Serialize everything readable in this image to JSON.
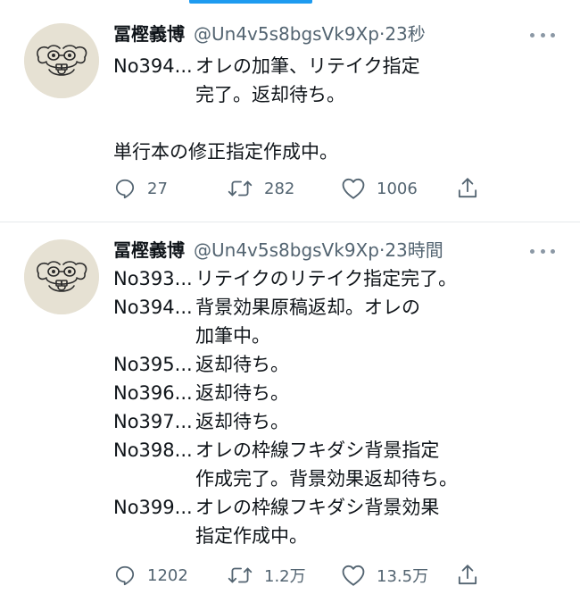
{
  "tweets": [
    {
      "name": "冨樫義博",
      "handle": "@Un4v5s8bgsVk9Xp",
      "time": "23秒",
      "lines": [
        {
          "pre": "No394...",
          "text": "オレの加筆、リテイク指定"
        },
        {
          "pre": "",
          "text": "完了。返却待ち。"
        },
        {
          "pre": "",
          "text": ""
        },
        {
          "pre": "",
          "text": "単行本の修正指定作成中。"
        }
      ],
      "replies": "27",
      "retweets": "282",
      "likes": "1006"
    },
    {
      "name": "冨樫義博",
      "handle": "@Un4v5s8bgsVk9Xp",
      "time": "23時間",
      "lines": [
        {
          "pre": "No393...",
          "text": "リテイクのリテイク指定完了。"
        },
        {
          "pre": "No394...",
          "text": "背景効果原稿返却。オレの"
        },
        {
          "pre": "",
          "text": "加筆中。"
        },
        {
          "pre": "No395...",
          "text": "返却待ち。"
        },
        {
          "pre": "No396...",
          "text": "返却待ち。"
        },
        {
          "pre": "No397...",
          "text": "返却待ち。"
        },
        {
          "pre": "No398...",
          "text": "オレの枠線フキダシ背景指定"
        },
        {
          "pre": "",
          "text": "作成完了。背景効果返却待ち。"
        },
        {
          "pre": "No399...",
          "text": "オレの枠線フキダシ背景効果"
        },
        {
          "pre": "",
          "text": "指定作成中。"
        }
      ],
      "replies": "1202",
      "retweets": "1.2万",
      "likes": "13.5万"
    }
  ],
  "icons": {
    "reply": "reply-icon",
    "retweet": "retweet-icon",
    "like": "heart-icon",
    "share": "share-icon",
    "more": "more-icon",
    "avatar": "dog-face-avatar"
  },
  "colors": {
    "accent": "#1d9bf0",
    "text": "#0f1419",
    "secondary": "#536471"
  }
}
